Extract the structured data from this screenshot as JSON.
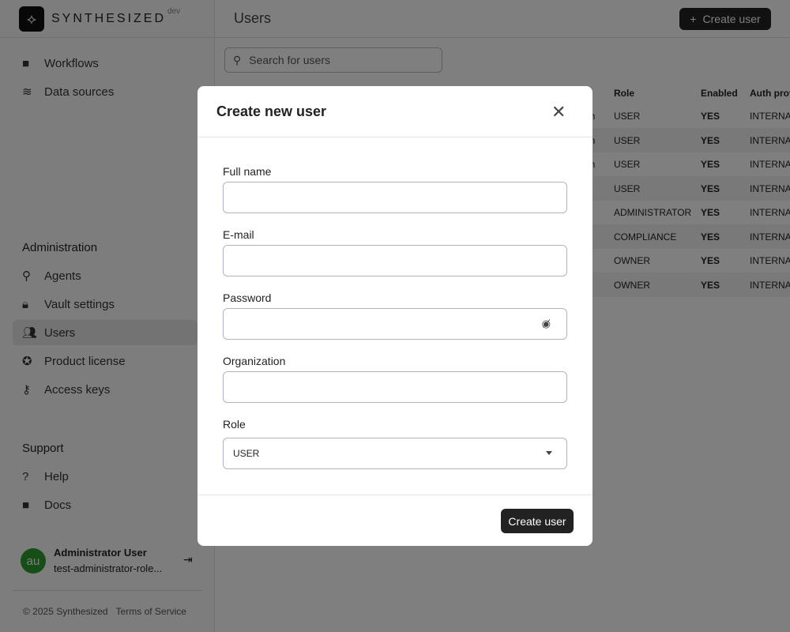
{
  "brand": {
    "name": "SYNTHESIZED",
    "env": "dev"
  },
  "sidebar": {
    "items": [
      {
        "label": "Workflows",
        "icon": "folder-icon"
      },
      {
        "label": "Data sources",
        "icon": "database-icon"
      }
    ],
    "admin_heading": "Administration",
    "admin_items": [
      {
        "label": "Agents"
      },
      {
        "label": "Vault settings"
      },
      {
        "label": "Users"
      },
      {
        "label": "Product license"
      },
      {
        "label": "Access keys"
      }
    ],
    "support_heading": "Support",
    "support_items": [
      {
        "label": "Help"
      },
      {
        "label": "Docs"
      }
    ],
    "user": {
      "initials": "au",
      "name": "Administrator User",
      "email": "test-administrator-role..."
    },
    "footer": {
      "copyright": "© 2025 Synthesized",
      "terms": "Terms of Service"
    }
  },
  "header": {
    "title": "Users",
    "create_label": "Create user"
  },
  "search": {
    "placeholder": "Search for users"
  },
  "table": {
    "headers": [
      "Role",
      "Enabled",
      "Auth prov"
    ],
    "rows": [
      {
        "frag": "on",
        "role": "USER",
        "enabled": "YES",
        "auth": "INTERNAL"
      },
      {
        "frag": "on",
        "role": "USER",
        "enabled": "YES",
        "auth": "INTERNAL"
      },
      {
        "frag": "on",
        "role": "USER",
        "enabled": "YES",
        "auth": "INTERNAL"
      },
      {
        "frag": "",
        "role": "USER",
        "enabled": "YES",
        "auth": "INTERNAL"
      },
      {
        "frag": "",
        "role": "ADMINISTRATOR",
        "enabled": "YES",
        "auth": "INTERNAL"
      },
      {
        "frag": "",
        "role": "COMPLIANCE",
        "enabled": "YES",
        "auth": "INTERNAL"
      },
      {
        "frag": "",
        "role": "OWNER",
        "enabled": "YES",
        "auth": "INTERNAL"
      },
      {
        "frag": "",
        "role": "OWNER",
        "enabled": "YES",
        "auth": "INTERNAL"
      }
    ]
  },
  "modal": {
    "title": "Create new user",
    "fields": {
      "full_name": {
        "label": "Full name",
        "value": ""
      },
      "email": {
        "label": "E-mail",
        "value": ""
      },
      "password": {
        "label": "Password",
        "value": ""
      },
      "organization": {
        "label": "Organization",
        "value": ""
      },
      "role": {
        "label": "Role",
        "value": "USER"
      }
    },
    "submit": "Create user"
  }
}
